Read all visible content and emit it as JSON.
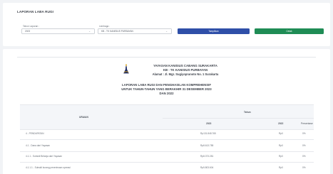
{
  "filters": {
    "title": "LAPORAN LABA RUGI",
    "year_label": "Tahun Laporan :",
    "year_value": "2023",
    "unit_label": "Lembaga :",
    "unit_value": "KB - TK KANISIUS PURBAYAN",
    "show_button": "Tampilkan",
    "print_button": "Cetak"
  },
  "colors": {
    "show_button": "#2f4fa8",
    "print_button": "#1f8c55"
  },
  "report": {
    "org_name": "YAYASAN KANISIUS CABANG SURAKARTA",
    "unit_name": "KB - TK KANISIUS PURBAYAN",
    "address": "Alamat : Jl. Mgr. Sugiyopranoto No. 1 Surakarta",
    "title_line1": "LAPORAN LABA RUGI DAN PENGHASILAN KOMPREHENSIF",
    "title_line2": "UNTUK TAHUN-TAHUN YANG BERAKHIR 31 DESEMBER 2023",
    "title_line3": "DAN 2022"
  },
  "table": {
    "col_uraian": "URAIAN",
    "col_tahun": "Tahun",
    "col_2023": "2023",
    "col_2022": "2022",
    "col_persen": "Persentase",
    "rows": [
      {
        "uraian": "4 - PENDAPATAN",
        "v2023": "Rp131.848.765",
        "v2022": "Rp0",
        "pct": "0%"
      },
      {
        "uraian": "4.1 - Dana dari Yayasan",
        "v2023": "Rp8.613.785",
        "v2022": "Rp0",
        "pct": "0%"
      },
      {
        "uraian": "4.1.1 - Subsidi Belanja dari Yayasan",
        "v2023": "Rp8.373.281",
        "v2022": "Rp0",
        "pct": "0%"
      },
      {
        "uraian": "4.1.1.1 - Subsidi kurang penerimaan operasi",
        "v2023": "Rp5.803.604",
        "v2022": "Rp0",
        "pct": "0%"
      }
    ]
  }
}
